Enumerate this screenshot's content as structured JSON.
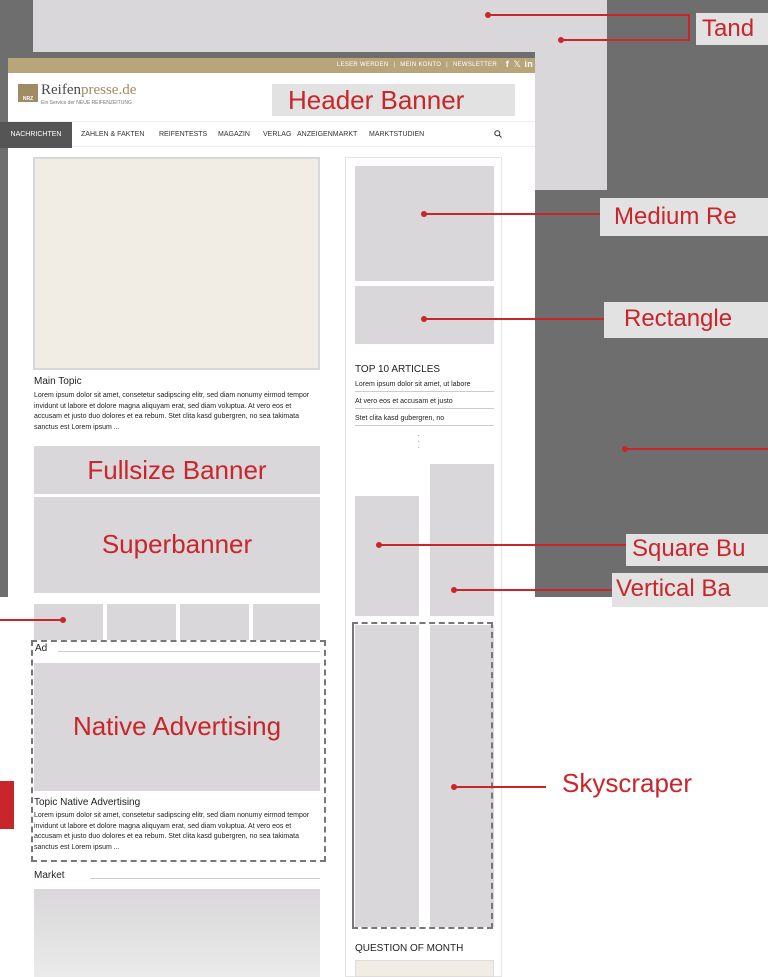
{
  "site": {
    "logo_main": "Reifen",
    "logo_accent": "presse.de",
    "logo_sub": "Ein Service der NEUE REIFENZEITUNG",
    "logo_mark": "NRZ",
    "topbar": {
      "links": [
        "LESER WERDEN",
        "|",
        "MEIN KONTO",
        "|",
        "NEWSLETTER"
      ],
      "social": [
        "f",
        "𝕏",
        "in"
      ]
    },
    "nav": [
      "NACHRICHTEN",
      "ZAHLEN & FAKTEN",
      "REIFENTESTS",
      "MAGAZIN",
      "VERLAG",
      "ANZEIGENMARKT",
      "MARKTSTUDIEN"
    ]
  },
  "ads": {
    "header_banner": "Header Banner",
    "fullsize_banner": "Fullsize Banner",
    "superbanner": "Superbanner",
    "native_advertising": "Native Advertising"
  },
  "callouts": {
    "tandem": "Tand",
    "medium_rectangle": "Medium Re",
    "rectangle": "Rectangle",
    "square_button": "Square Bu",
    "vertical_banner": "Vertical Ba",
    "skyscraper": "Skyscraper"
  },
  "main_topic": {
    "title": "Main Topic",
    "body": "Lorem ipsum dolor sit amet, consetetur sadipscing elitr, sed diam nonumy eirmod tempor invidunt ut labore et dolore magna aliquyam erat, sed diam voluptua. At vero eos et accusam et justo duo dolores et ea rebum. Stet clita kasd gubergren, no sea takimata sanctus est Lorem ipsum ..."
  },
  "native": {
    "ad_label": "Ad",
    "title": "Topic Native Advertising",
    "body": "Lorem ipsum dolor sit amet, consetetur sadipscing elitr, sed diam nonumy eirmod tempor invidunt ut labore et dolore magna aliquyam erat, sed diam voluptua. At vero eos et accusam et justo duo dolores et ea rebum. Stet clita kasd gubergren, no sea takimata sanctus est Lorem ipsum ..."
  },
  "market": {
    "title": "Market"
  },
  "sidebar": {
    "top10_title": "TOP 10 ARTICLES",
    "articles": [
      "Lorem ipsum dolor sit amet, ut labore",
      "At vero eos et accusam et justo",
      "Stet clita kasd gubergren, no"
    ],
    "ellipsis": ".\n.\n.",
    "question_title": "QUESTION OF MONTH"
  },
  "colors": {
    "accent_red": "#c8262a",
    "placeholder_gray": "#d9d7d9",
    "topbar_gold": "#b9a57a",
    "nav_active": "#555555",
    "dark_bg": "#6e6e6e"
  }
}
